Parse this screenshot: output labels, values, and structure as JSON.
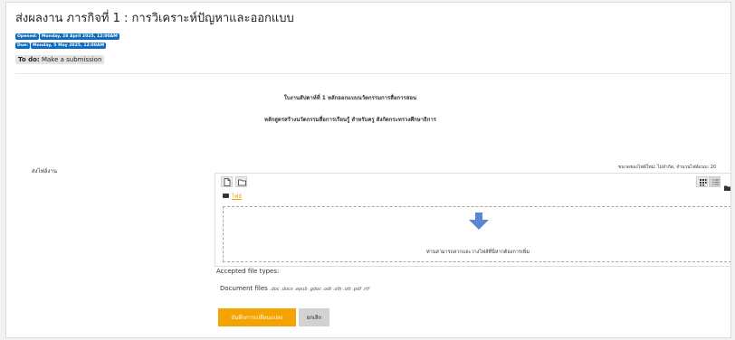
{
  "page": {
    "title": "ส่งผลงาน ภารกิจที่ 1 : การวิเคราะห์ปัญหาและออกแบบ"
  },
  "dates": {
    "opened_label": "Opened:",
    "opened_value": "Monday, 28 April 2025, 12:00AM",
    "due_label": "Due:",
    "due_value": "Monday, 5 May 2025, 12:00AM"
  },
  "todo": {
    "label": "To do:",
    "text": "Make a submission"
  },
  "description": {
    "line1": "ใบงานสัปดาห์ที่ 1 หลักออกแบบนวัตกรรมการสื่อการสอน",
    "line2": "หลักสูตรสร้างนวัตกรรมสื่อการเรียนรู้ สำหรับครู สังกัดกระทรวงศึกษาธิการ"
  },
  "submission": {
    "field_label": "ส่งไฟล์งาน",
    "max_size": "ขนาดของไฟล์ใหม่: ไม่จำกัด, จำนวนไฟล์แนบ: 20",
    "path_link": "ไฟล์",
    "drop_text": "ท่านสามารถลากและวางไฟล์ที่นี่หากต้องการเพิ่ม",
    "accepted_label": "Accepted file types:",
    "doc_files_label": "Document files",
    "doc_files_ext": ".doc .docx .epub .gdoc .odt .oth .ott .pdf .rtf"
  },
  "buttons": {
    "save": "บันทึกการเปลี่ยนแปลง",
    "cancel": "ยกเลิก"
  },
  "colors": {
    "primary": "#0f6cbf",
    "save_button": "#f4a300",
    "drop_arrow": "#5b86d6"
  },
  "icons": {
    "add_file": "file-icon",
    "create_folder": "folder-icon",
    "view_icons": "grid-icon",
    "view_list": "list-icon",
    "view_tree": "folder-tree-icon",
    "drop_arrow": "arrow-down-icon"
  }
}
